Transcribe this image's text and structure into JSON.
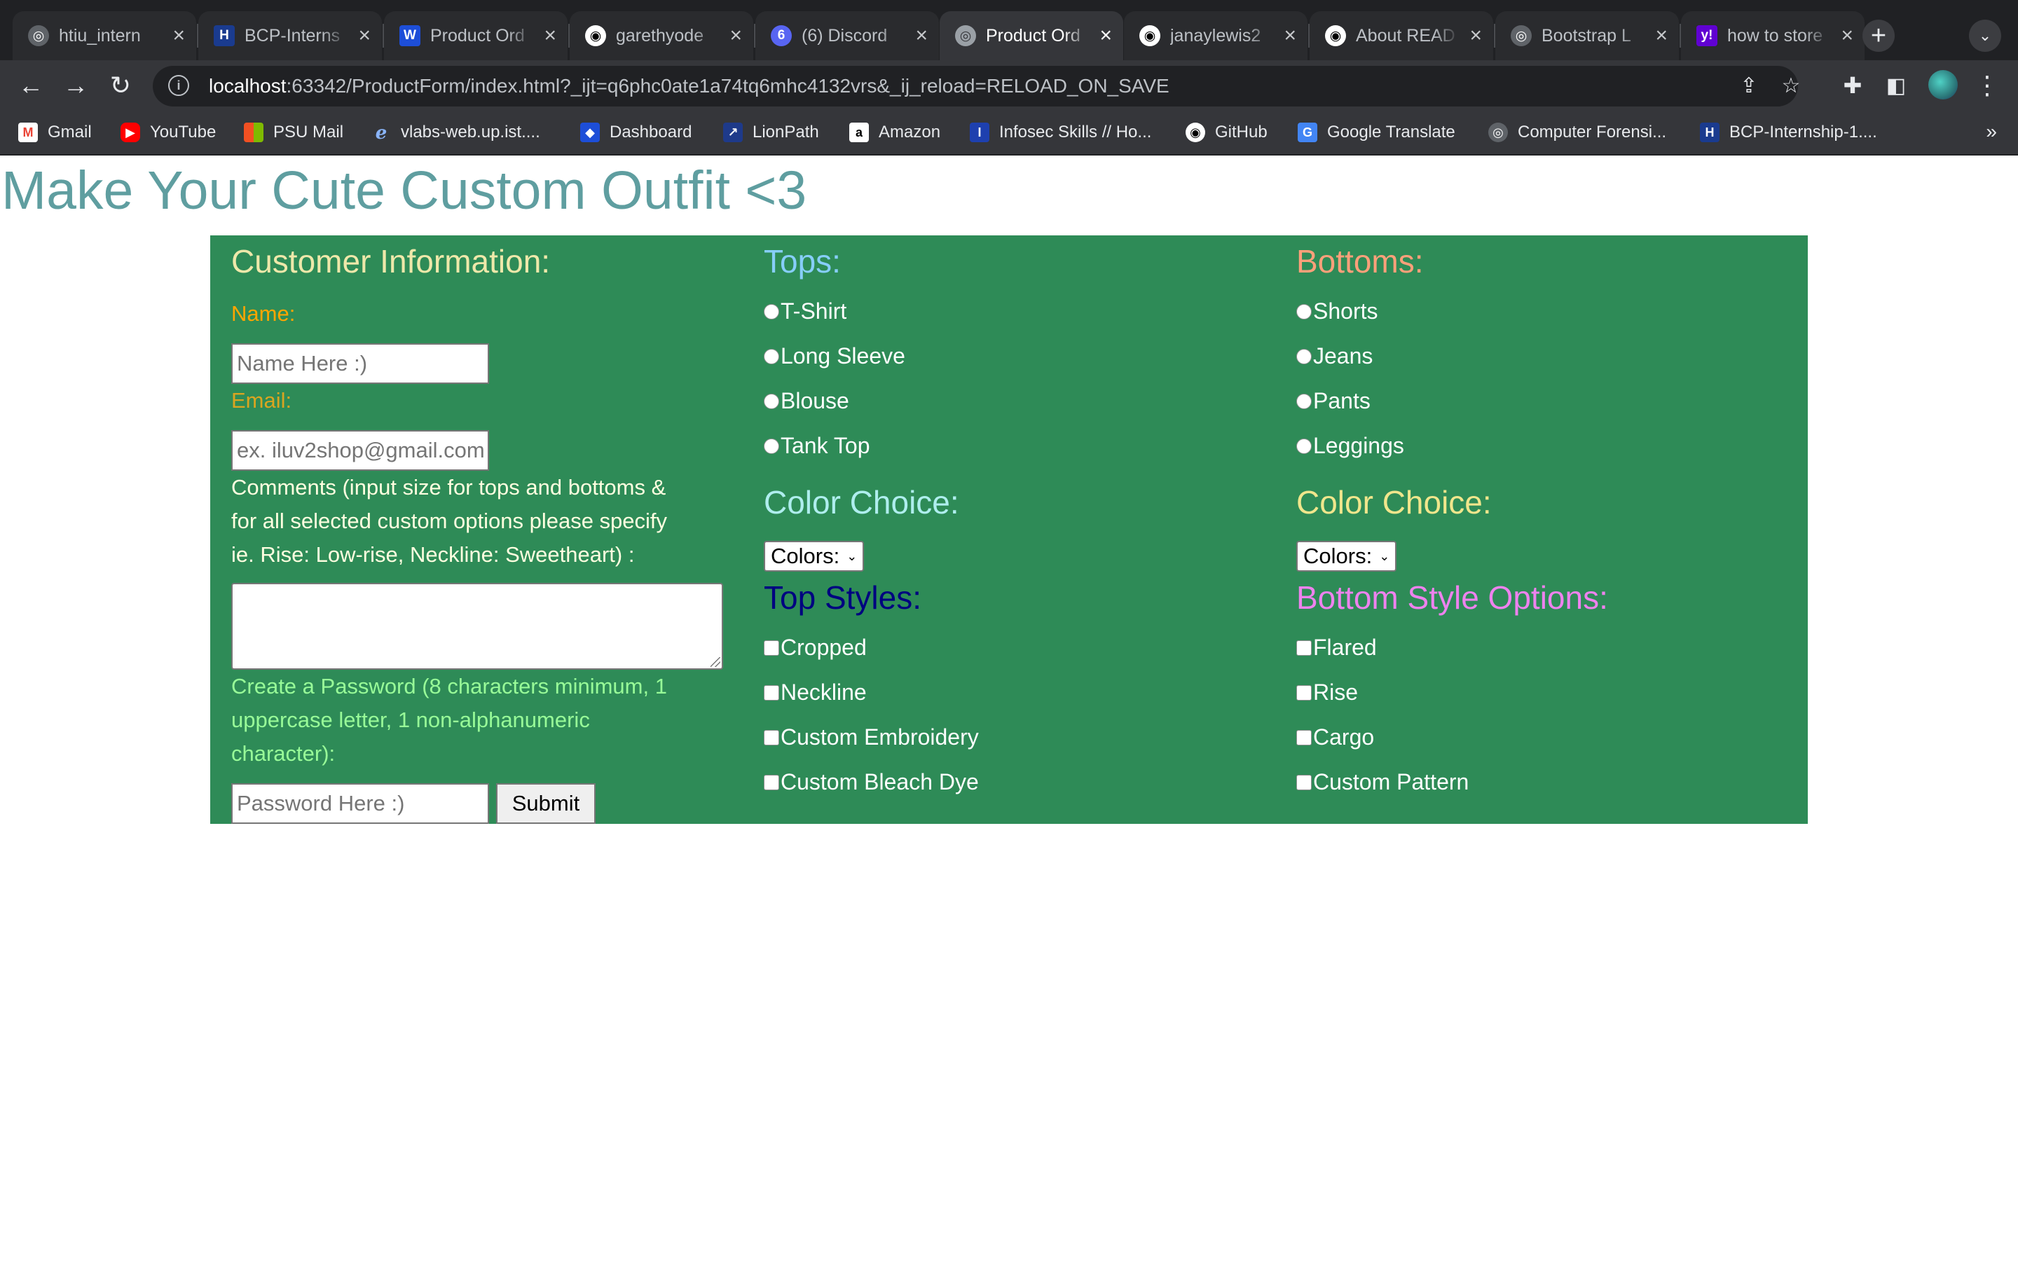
{
  "browser": {
    "tabs": [
      {
        "title": "htiu_intern",
        "icon": "globe-icon"
      },
      {
        "title": "BCP-Interns",
        "icon": "bcp-icon"
      },
      {
        "title": "Product Ord",
        "icon": "webstorm-icon"
      },
      {
        "title": "garethyode",
        "icon": "github-icon"
      },
      {
        "title": "(6) Discord",
        "icon": "discord-icon",
        "badge": "6"
      },
      {
        "title": "Product Ord",
        "icon": "globe-icon",
        "active": true
      },
      {
        "title": "janaylewis2",
        "icon": "github-icon"
      },
      {
        "title": "About READ",
        "icon": "github-icon"
      },
      {
        "title": "Bootstrap L",
        "icon": "globe-icon"
      },
      {
        "title": "how to store",
        "icon": "yahoo-icon"
      }
    ],
    "url_host": "localhost",
    "url_rest": ":63342/ProductForm/index.html?_ijt=q6phc0ate1a74tq6mhc4132vrs&_ij_reload=RELOAD_ON_SAVE",
    "bookmarks": [
      {
        "label": "Gmail",
        "icon": "gmail-icon"
      },
      {
        "label": "YouTube",
        "icon": "youtube-icon"
      },
      {
        "label": "PSU Mail",
        "icon": "microsoft-icon"
      },
      {
        "label": "vlabs-web.up.ist....",
        "icon": "vlabs-icon"
      },
      {
        "label": "Dashboard",
        "icon": "dashboard-icon"
      },
      {
        "label": "LionPath",
        "icon": "lionpath-icon"
      },
      {
        "label": "Amazon",
        "icon": "amazon-icon"
      },
      {
        "label": "Infosec Skills // Ho...",
        "icon": "infosec-icon"
      },
      {
        "label": "GitHub",
        "icon": "github-icon"
      },
      {
        "label": "Google Translate",
        "icon": "translate-icon"
      },
      {
        "label": "Computer Forensi...",
        "icon": "forensics-icon"
      },
      {
        "label": "BCP-Internship-1....",
        "icon": "bcp-icon"
      }
    ],
    "bookmarks_more": "»"
  },
  "page": {
    "title": "Make Your Cute Custom Outfit <3"
  },
  "customer": {
    "heading": "Customer Information:",
    "name_label": "Name:",
    "name_placeholder": "Name Here :)",
    "email_label": "Email:",
    "email_placeholder": "ex. iluv2shop@gmail.com",
    "comments_label_1": "Comments (input size for tops and bottoms &",
    "comments_label_2": "for all selected custom options please specify",
    "comments_label_3": "ie. Rise: Low-rise, Neckline: Sweetheart) :",
    "comments_value": "",
    "password_label_1": "Create a Password (8 characters minimum, 1",
    "password_label_2": "uppercase letter, 1 non-alphanumeric",
    "password_label_3": "character):",
    "password_placeholder": "Password Here :)",
    "submit_label": "Submit"
  },
  "tops": {
    "heading": "Tops:",
    "options": [
      "T-Shirt",
      "Long Sleeve",
      "Blouse",
      "Tank Top"
    ],
    "color_heading": "Color Choice:",
    "color_select": "Colors:",
    "styles_heading": "Top Styles:",
    "styles": [
      "Cropped",
      "Neckline",
      "Custom Embroidery",
      "Custom Bleach Dye"
    ]
  },
  "bottoms": {
    "heading": "Bottoms:",
    "options": [
      "Shorts",
      "Jeans",
      "Pants",
      "Leggings"
    ],
    "color_heading": "Color Choice:",
    "color_select": "Colors:",
    "styles_heading": "Bottom Style Options:",
    "styles": [
      "Flared",
      "Rise",
      "Cargo",
      "Custom Pattern"
    ]
  },
  "colors": {
    "title": "#5f9ea0",
    "panel": "#2e8b57",
    "customer_heading": "#eee8aa",
    "name_label": "#ffa500",
    "email_label": "#daa520",
    "comments_label": "#ffffe0",
    "password_label": "#98fb98",
    "tops_heading": "#87cefa",
    "tops_color_heading": "#afeeee",
    "top_styles_heading": "#000080",
    "bottoms_heading": "#ffa07a",
    "bottoms_color_heading": "#f0e68c",
    "bottom_styles_heading": "#ee82ee"
  }
}
